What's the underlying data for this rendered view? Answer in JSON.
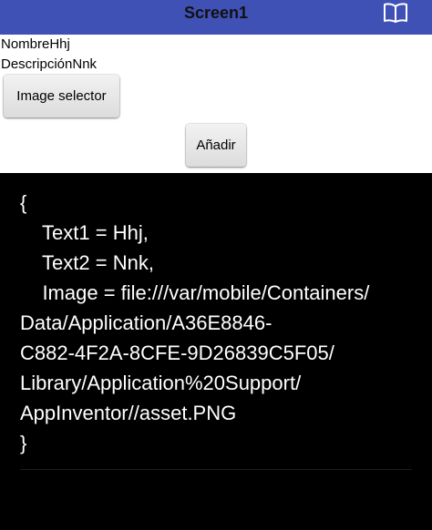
{
  "titlebar": {
    "title": "Screen1",
    "icon": "book-icon",
    "background": "#3f51b5"
  },
  "form": {
    "name_label": "NombreHhj",
    "description_label": "DescripciónNnk",
    "image_selector_button": "Image selector",
    "add_button": "Añadir"
  },
  "dialog": {
    "lines": [
      "{",
      "    Text1 = Hhj,",
      "    Text2 = Nnk,",
      "    Image = file:///var/mobile/Containers/",
      "Data/Application/A36E8846-",
      "C882-4F2A-8CFE-9D26839C5F05/",
      "Library/Application%20Support/",
      "AppInventor//asset.PNG",
      "}"
    ],
    "background": "#000000",
    "text_color": "#ffffff"
  }
}
